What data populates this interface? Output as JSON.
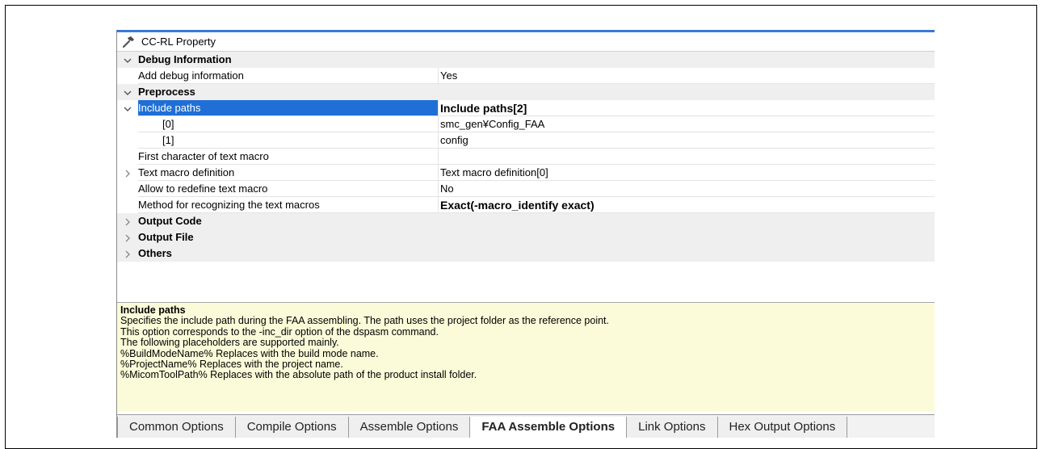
{
  "window": {
    "title": "CC-RL Property"
  },
  "rows": [
    {
      "type": "category",
      "expander": "down",
      "name": "Debug Information"
    },
    {
      "type": "prop",
      "name": "Add debug information",
      "value": "Yes"
    },
    {
      "type": "category",
      "expander": "down",
      "name": "Preprocess"
    },
    {
      "type": "prop",
      "expander": "down",
      "name": "Include paths",
      "value": "Include paths[2]",
      "selected": true,
      "bold": true
    },
    {
      "type": "sub",
      "name": "[0]",
      "value": "smc_gen¥Config_FAA"
    },
    {
      "type": "sub",
      "name": "[1]",
      "value": "config"
    },
    {
      "type": "prop",
      "name": "First character of text macro",
      "value": ""
    },
    {
      "type": "prop",
      "expander": "right",
      "name": "Text macro definition",
      "value": "Text macro definition[0]"
    },
    {
      "type": "prop",
      "name": "Allow to redefine text macro",
      "value": "No"
    },
    {
      "type": "prop",
      "name": "Method for recognizing the text macros",
      "value": "Exact(-macro_identify exact)",
      "bold": true
    },
    {
      "type": "category",
      "expander": "right",
      "name": "Output Code"
    },
    {
      "type": "category",
      "expander": "right",
      "name": "Output File"
    },
    {
      "type": "category",
      "expander": "right",
      "name": "Others"
    }
  ],
  "description": {
    "title": "Include paths",
    "lines": [
      "Specifies the include path during the FAA assembling. The path uses the project folder as the reference point.",
      "This option corresponds to the -inc_dir option of the dspasm command.",
      "The following placeholders are supported mainly.",
      "%BuildModeName% Replaces with the build mode name.",
      "%ProjectName% Replaces with the project name.",
      "%MicomToolPath% Replaces with the absolute path of the product install folder."
    ]
  },
  "tabs": [
    {
      "label": "Common Options"
    },
    {
      "label": "Compile Options"
    },
    {
      "label": "Assemble Options"
    },
    {
      "label": "FAA Assemble Options",
      "active": true
    },
    {
      "label": "Link Options"
    },
    {
      "label": "Hex Output Options"
    }
  ],
  "colors": {
    "accent": "#3b78d8",
    "selection": "#1f6fd6",
    "description_bg": "#fbfbd9"
  }
}
